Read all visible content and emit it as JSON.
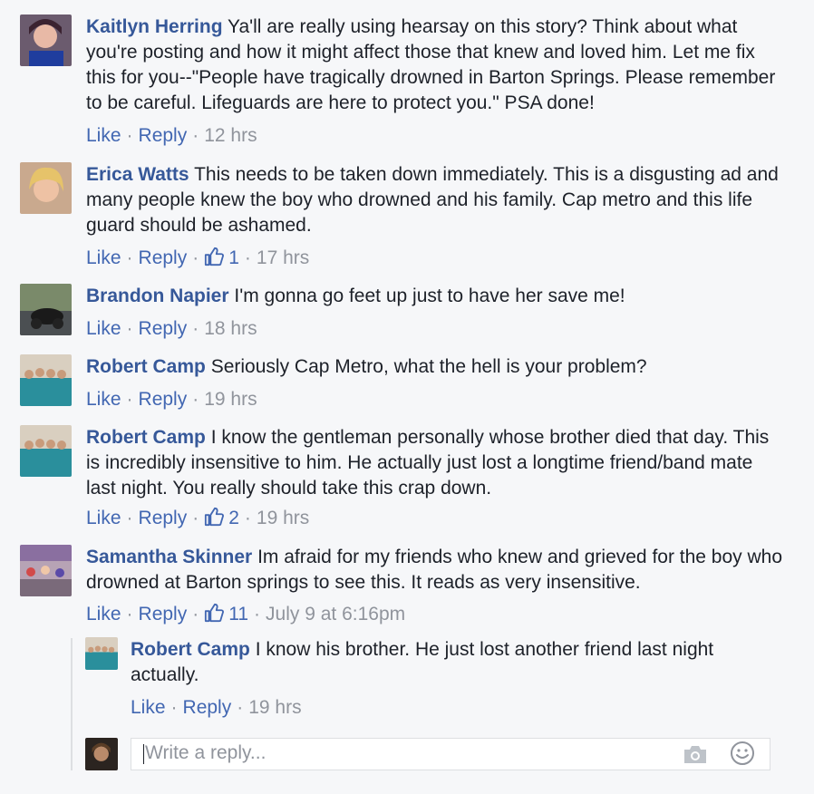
{
  "comments": [
    {
      "author": "Kaitlyn Herring",
      "text": "Ya'll are really using hearsay on this story? Think about what you're posting and how it might affect those that knew and loved him. Let me fix this for you--\"People have tragically drowned in Barton Springs. Please remember to be careful. Lifeguards are here to protect you.\" PSA done!",
      "like": "Like",
      "reply": "Reply",
      "likes": "",
      "time": "12 hrs"
    },
    {
      "author": "Erica Watts",
      "text": "This needs to be taken down immediately. This is a disgusting ad and many people knew the boy who drowned and his family. Cap metro and this life guard should be ashamed.",
      "like": "Like",
      "reply": "Reply",
      "likes": "1",
      "time": "17 hrs"
    },
    {
      "author": "Brandon Napier",
      "text": "I'm gonna go feet up just to have her save me!",
      "like": "Like",
      "reply": "Reply",
      "likes": "",
      "time": "18 hrs"
    },
    {
      "author": "Robert Camp",
      "text": "Seriously Cap Metro, what the hell is your problem?",
      "like": "Like",
      "reply": "Reply",
      "likes": "",
      "time": "19 hrs"
    },
    {
      "author": "Robert Camp",
      "text": "I know the gentleman personally whose brother died that day. This is incredibly insensitive to him. He actually just lost a longtime friend/band mate last night. You really should take this crap down.",
      "like": "Like",
      "reply": "Reply",
      "likes": "2",
      "time": "19 hrs"
    },
    {
      "author": "Samantha Skinner",
      "text": "Im afraid for my friends who knew and grieved for the boy who drowned at Barton springs to see this. It reads as very insensitive.",
      "like": "Like",
      "reply": "Reply",
      "likes": "11",
      "time": "July 9 at 6:16pm"
    }
  ],
  "reply": {
    "author": "Robert Camp",
    "text": "I know his brother. He just lost another friend last night actually.",
    "like": "Like",
    "reply": "Reply",
    "time": "19 hrs"
  },
  "composer": {
    "placeholder": "Write a reply..."
  },
  "icons": {
    "like_count": "thumbs-up-icon",
    "photo": "camera-icon",
    "emoji": "smiley-icon"
  },
  "colors": {
    "author": "#365899",
    "link": "#4267b2",
    "muted": "#90949c",
    "background": "#f6f7f9"
  }
}
